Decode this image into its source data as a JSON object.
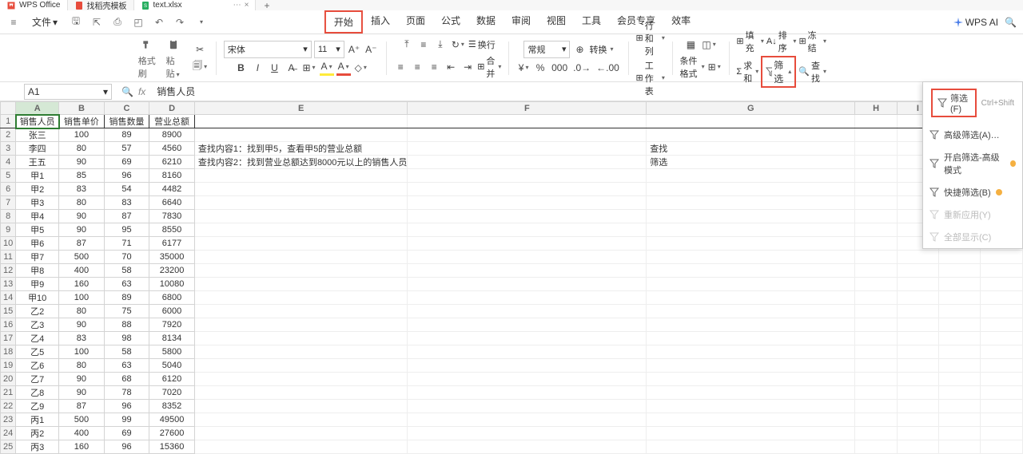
{
  "titlebar": {
    "tabs": [
      {
        "label": "WPS Office",
        "type": "wps"
      },
      {
        "label": "找稻壳模板",
        "type": "doc"
      },
      {
        "label": "text.xlsx",
        "type": "sheet"
      }
    ],
    "plus": "+"
  },
  "menubar": {
    "file": "文件",
    "tabs": [
      "开始",
      "插入",
      "页面",
      "公式",
      "数据",
      "审阅",
      "视图",
      "工具",
      "会员专享",
      "效率"
    ],
    "active_tab": 0,
    "ai_label": "WPS AI"
  },
  "ribbon": {
    "format_painter": "格式刷",
    "paste": "粘贴",
    "font_name": "宋体",
    "font_size": "11",
    "number_format": "常规",
    "convert": "转换",
    "row_col": "行和列",
    "worksheet": "工作表",
    "cond_format": "条件格式",
    "wrap": "换行",
    "merge": "合并",
    "sum": "求和",
    "fill": "填充",
    "sort": "排序",
    "freeze": "冻结",
    "filter": "筛选",
    "find": "查找"
  },
  "filter_popup": {
    "items": [
      {
        "label": "筛选(F)",
        "shortcut": "Ctrl+Shift",
        "highlighted": true
      },
      {
        "label": "高级筛选(A)…"
      },
      {
        "label": "开启筛选-高级模式",
        "badge": true
      },
      {
        "label": "快捷筛选(B)",
        "badge": true
      },
      {
        "label": "重新应用(Y)",
        "disabled": true
      },
      {
        "label": "全部显示(C)",
        "disabled": true
      }
    ]
  },
  "formulabar": {
    "cell_ref": "A1",
    "formula": "销售人员"
  },
  "sheet": {
    "columns": [
      "A",
      "B",
      "C",
      "D",
      "E",
      "F",
      "G",
      "H",
      "I",
      "J",
      "K"
    ],
    "headers": [
      "销售人员",
      "销售单价",
      "销售数量",
      "营业总额"
    ],
    "rows": [
      {
        "n": 2,
        "a": "张三",
        "b": 100,
        "c": 89,
        "d": 8900
      },
      {
        "n": 3,
        "a": "李四",
        "b": 80,
        "c": 57,
        "d": 4560
      },
      {
        "n": 4,
        "a": "王五",
        "b": 90,
        "c": 69,
        "d": 6210
      },
      {
        "n": 5,
        "a": "甲1",
        "b": 85,
        "c": 96,
        "d": 8160
      },
      {
        "n": 6,
        "a": "甲2",
        "b": 83,
        "c": 54,
        "d": 4482
      },
      {
        "n": 7,
        "a": "甲3",
        "b": 80,
        "c": 83,
        "d": 6640
      },
      {
        "n": 8,
        "a": "甲4",
        "b": 90,
        "c": 87,
        "d": 7830
      },
      {
        "n": 9,
        "a": "甲5",
        "b": 90,
        "c": 95,
        "d": 8550
      },
      {
        "n": 10,
        "a": "甲6",
        "b": 87,
        "c": 71,
        "d": 6177
      },
      {
        "n": 11,
        "a": "甲7",
        "b": 500,
        "c": 70,
        "d": 35000
      },
      {
        "n": 12,
        "a": "甲8",
        "b": 400,
        "c": 58,
        "d": 23200
      },
      {
        "n": 13,
        "a": "甲9",
        "b": 160,
        "c": 63,
        "d": 10080
      },
      {
        "n": 14,
        "a": "甲10",
        "b": 100,
        "c": 89,
        "d": 6800
      },
      {
        "n": 15,
        "a": "乙2",
        "b": 80,
        "c": 75,
        "d": 6000
      },
      {
        "n": 16,
        "a": "乙3",
        "b": 90,
        "c": 88,
        "d": 7920
      },
      {
        "n": 17,
        "a": "乙4",
        "b": 83,
        "c": 98,
        "d": 8134
      },
      {
        "n": 18,
        "a": "乙5",
        "b": 100,
        "c": 58,
        "d": 5800
      },
      {
        "n": 19,
        "a": "乙6",
        "b": 80,
        "c": 63,
        "d": 5040
      },
      {
        "n": 20,
        "a": "乙7",
        "b": 90,
        "c": 68,
        "d": 6120
      },
      {
        "n": 21,
        "a": "乙8",
        "b": 90,
        "c": 78,
        "d": 7020
      },
      {
        "n": 22,
        "a": "乙9",
        "b": 87,
        "c": 96,
        "d": 8352
      },
      {
        "n": 23,
        "a": "丙1",
        "b": 500,
        "c": 99,
        "d": 49500
      },
      {
        "n": 24,
        "a": "丙2",
        "b": 400,
        "c": 69,
        "d": 27600
      },
      {
        "n": 25,
        "a": "丙3",
        "b": 160,
        "c": 96,
        "d": 15360
      }
    ],
    "free_text": {
      "e3": "查找内容1：找到甲5，查看甲5的营业总额",
      "e4": "查找内容2：找到营业总额达到8000元以上的销售人员",
      "g3": "查找",
      "g4": "筛选"
    }
  }
}
